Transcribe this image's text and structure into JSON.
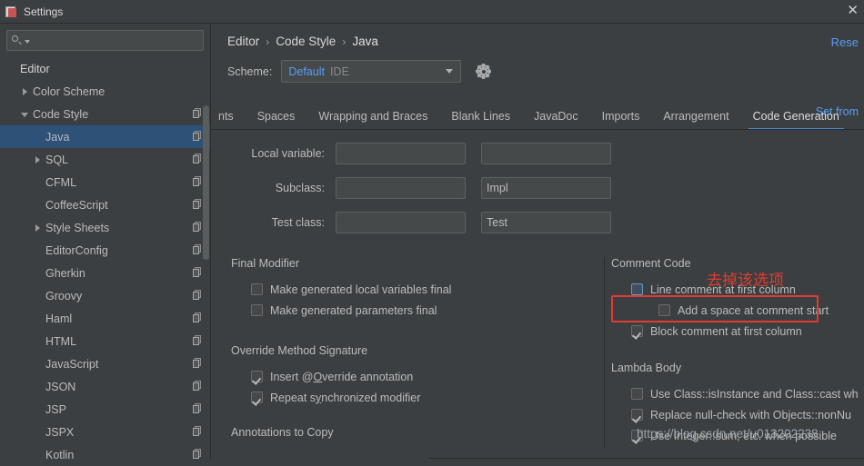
{
  "window": {
    "title": "Settings",
    "app_icon": "settings-app-icon",
    "close_label": "✕"
  },
  "sidebar": {
    "search": {
      "value": "",
      "placeholder": "",
      "icon": "search-icon"
    },
    "items": [
      {
        "label": "Editor",
        "indent": 0,
        "arrow": "none",
        "bold": true,
        "copy": false,
        "selected": false
      },
      {
        "label": "Color Scheme",
        "indent": 1,
        "arrow": "right",
        "bold": false,
        "copy": false,
        "selected": false
      },
      {
        "label": "Code Style",
        "indent": 1,
        "arrow": "down",
        "bold": false,
        "copy": true,
        "selected": false
      },
      {
        "label": "Java",
        "indent": 2,
        "arrow": "none",
        "bold": false,
        "copy": true,
        "selected": true
      },
      {
        "label": "SQL",
        "indent": 2,
        "arrow": "right",
        "bold": false,
        "copy": true,
        "selected": false
      },
      {
        "label": "CFML",
        "indent": 2,
        "arrow": "none",
        "bold": false,
        "copy": true,
        "selected": false
      },
      {
        "label": "CoffeeScript",
        "indent": 2,
        "arrow": "none",
        "bold": false,
        "copy": true,
        "selected": false
      },
      {
        "label": "Style Sheets",
        "indent": 2,
        "arrow": "right",
        "bold": false,
        "copy": true,
        "selected": false
      },
      {
        "label": "EditorConfig",
        "indent": 2,
        "arrow": "none",
        "bold": false,
        "copy": true,
        "selected": false
      },
      {
        "label": "Gherkin",
        "indent": 2,
        "arrow": "none",
        "bold": false,
        "copy": true,
        "selected": false
      },
      {
        "label": "Groovy",
        "indent": 2,
        "arrow": "none",
        "bold": false,
        "copy": true,
        "selected": false
      },
      {
        "label": "Haml",
        "indent": 2,
        "arrow": "none",
        "bold": false,
        "copy": true,
        "selected": false
      },
      {
        "label": "HTML",
        "indent": 2,
        "arrow": "none",
        "bold": false,
        "copy": true,
        "selected": false
      },
      {
        "label": "JavaScript",
        "indent": 2,
        "arrow": "none",
        "bold": false,
        "copy": true,
        "selected": false
      },
      {
        "label": "JSON",
        "indent": 2,
        "arrow": "none",
        "bold": false,
        "copy": true,
        "selected": false
      },
      {
        "label": "JSP",
        "indent": 2,
        "arrow": "none",
        "bold": false,
        "copy": true,
        "selected": false
      },
      {
        "label": "JSPX",
        "indent": 2,
        "arrow": "none",
        "bold": false,
        "copy": true,
        "selected": false
      },
      {
        "label": "Kotlin",
        "indent": 2,
        "arrow": "none",
        "bold": false,
        "copy": true,
        "selected": false
      }
    ]
  },
  "main": {
    "breadcrumb": [
      "Editor",
      "Code Style",
      "Java"
    ],
    "breadcrumb_separator": "›",
    "reset_label": "Rese",
    "set_from_label": "Set from",
    "scheme": {
      "label": "Scheme:",
      "value": "Default",
      "value_suffix": "IDE",
      "gear_icon": "gear-icon"
    },
    "tabs": [
      {
        "label": "nts",
        "active": false,
        "clipped": true
      },
      {
        "label": "Spaces",
        "active": false
      },
      {
        "label": "Wrapping and Braces",
        "active": false
      },
      {
        "label": "Blank Lines",
        "active": false
      },
      {
        "label": "JavaDoc",
        "active": false
      },
      {
        "label": "Imports",
        "active": false
      },
      {
        "label": "Arrangement",
        "active": false
      },
      {
        "label": "Code Generation",
        "active": true
      }
    ],
    "name_fields": [
      {
        "label": "Local variable:",
        "prefix": "",
        "suffix": ""
      },
      {
        "label": "Subclass:",
        "prefix": "",
        "suffix": "Impl"
      },
      {
        "label": "Test class:",
        "prefix": "",
        "suffix": "Test"
      }
    ],
    "final_modifier": {
      "title": "Final Modifier",
      "options": [
        {
          "label": "Make generated local variables final",
          "checked": false
        },
        {
          "label": "Make generated parameters final",
          "checked": false
        }
      ]
    },
    "override_method_signature": {
      "title": "Override Method Signature",
      "options": [
        {
          "label": "Insert @Override annotation",
          "checked": true
        },
        {
          "label": "Repeat synchronized modifier",
          "checked": true
        }
      ]
    },
    "annotations_to_copy": {
      "title": "Annotations to Copy"
    },
    "comment_code": {
      "title": "Comment Code",
      "options": [
        {
          "label": "Line comment at first column",
          "checked": false,
          "highlighted": true,
          "indent": 1
        },
        {
          "label": "Add a space at comment start",
          "checked": false,
          "indent": 2
        },
        {
          "label": "Block comment at first column",
          "checked": true,
          "indent": 1
        }
      ]
    },
    "lambda_body": {
      "title": "Lambda Body",
      "options": [
        {
          "label": "Use Class::isInstance and Class::cast wh",
          "checked": false
        },
        {
          "label": "Replace null-check with Objects::nonNu",
          "checked": true
        },
        {
          "label": "Use Integer::sum, etc. when possible",
          "checked": true
        }
      ]
    }
  },
  "annotations": {
    "red_note": "去掉该选项",
    "watermark": "https://blog.csdn.net/u013202238"
  },
  "colors": {
    "accent_blue": "#589df6",
    "tab_underline": "#4a88c7",
    "selection": "#2d5177",
    "annotation_red": "#e03c31",
    "panel_bg": "#3c3f41",
    "input_bg": "#45494a"
  }
}
